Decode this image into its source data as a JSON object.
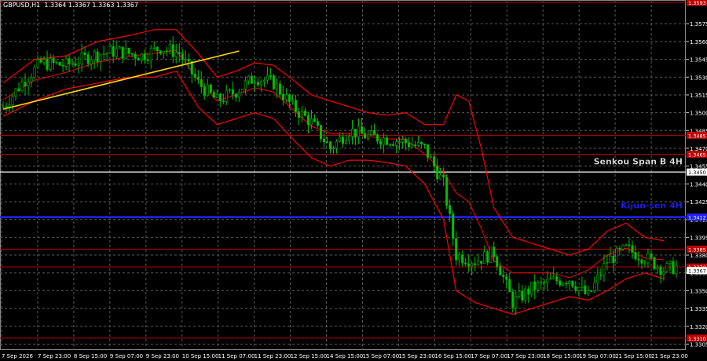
{
  "header": {
    "symbol": "GBPUSD,H1",
    "ohlc": "1.3364 1.3367 1.3363 1.3367"
  },
  "colors": {
    "background": "#000000",
    "grid": "#5a5a5a",
    "candle": "#00c000",
    "indicator": "#ff0000",
    "level_red": "#c00000",
    "senkou": "#e8e8e8",
    "kijun": "#2020ff",
    "trendline": "#ffd700"
  },
  "chart_data": {
    "type": "line",
    "title": "GBPUSD,H1",
    "ylim": [
      1.33,
      1.3595
    ],
    "grid": true,
    "y_ticks": [
      "1.3575",
      "1.3560",
      "1.3545",
      "1.3530",
      "1.3515",
      "1.3500",
      "1.3485",
      "1.3470",
      "1.3455",
      "1.3440",
      "1.3425",
      "1.3410",
      "1.3395",
      "1.3380",
      "1.3365",
      "1.3350",
      "1.3335",
      "1.3320",
      "1.3305"
    ],
    "x_ticks": [
      "7 Sep 2026",
      "7 Sep 23:00",
      "8 Sep 15:00",
      "9 Sep 07:00",
      "9 Sep 23:00",
      "10 Sep 15:00",
      "11 Sep 07:00",
      "11 Sep 23:00",
      "12 Sep 15:00",
      "14 Sep 15:00",
      "15 Sep 07:00",
      "15 Sep 23:00",
      "16 Sep 15:00",
      "17 Sep 07:00",
      "17 Sep 23:00",
      "18 Sep 15:00",
      "19 Sep 07:00",
      "21 Sep 15:00",
      "21 Sep 23:00"
    ],
    "price_path": [
      [
        0,
        1.3505
      ],
      [
        6,
        1.3525
      ],
      [
        12,
        1.3542
      ],
      [
        20,
        1.354
      ],
      [
        28,
        1.3548
      ],
      [
        36,
        1.3552
      ],
      [
        44,
        1.3548
      ],
      [
        50,
        1.3555
      ],
      [
        56,
        1.355
      ],
      [
        62,
        1.3525
      ],
      [
        68,
        1.351
      ],
      [
        74,
        1.3518
      ],
      [
        80,
        1.353
      ],
      [
        86,
        1.3525
      ],
      [
        92,
        1.3505
      ],
      [
        98,
        1.3492
      ],
      [
        104,
        1.347
      ],
      [
        110,
        1.3485
      ],
      [
        116,
        1.348
      ],
      [
        122,
        1.3478
      ],
      [
        128,
        1.3475
      ],
      [
        134,
        1.347
      ],
      [
        140,
        1.344
      ],
      [
        144,
        1.338
      ],
      [
        150,
        1.3375
      ],
      [
        156,
        1.3382
      ],
      [
        162,
        1.334
      ],
      [
        168,
        1.3352
      ],
      [
        174,
        1.3358
      ],
      [
        180,
        1.336
      ],
      [
        186,
        1.3345
      ],
      [
        192,
        1.3375
      ],
      [
        198,
        1.3385
      ],
      [
        204,
        1.3378
      ],
      [
        210,
        1.3368
      ],
      [
        214,
        1.337
      ]
    ],
    "bollinger_upper": [
      [
        0,
        1.3525
      ],
      [
        10,
        1.3545
      ],
      [
        20,
        1.3548
      ],
      [
        30,
        1.356
      ],
      [
        40,
        1.3565
      ],
      [
        48,
        1.357
      ],
      [
        55,
        1.357
      ],
      [
        62,
        1.355
      ],
      [
        68,
        1.353
      ],
      [
        74,
        1.3535
      ],
      [
        80,
        1.3542
      ],
      [
        86,
        1.354
      ],
      [
        92,
        1.3528
      ],
      [
        98,
        1.3515
      ],
      [
        104,
        1.351
      ],
      [
        110,
        1.3505
      ],
      [
        116,
        1.35
      ],
      [
        122,
        1.3498
      ],
      [
        128,
        1.35
      ],
      [
        134,
        1.349
      ],
      [
        140,
        1.349
      ],
      [
        144,
        1.3515
      ],
      [
        148,
        1.351
      ],
      [
        152,
        1.347
      ],
      [
        156,
        1.342
      ],
      [
        162,
        1.3395
      ],
      [
        168,
        1.339
      ],
      [
        174,
        1.3385
      ],
      [
        180,
        1.338
      ],
      [
        186,
        1.3385
      ],
      [
        192,
        1.34
      ],
      [
        198,
        1.3407
      ],
      [
        204,
        1.3395
      ],
      [
        210,
        1.3392
      ]
    ],
    "bollinger_lower": [
      [
        0,
        1.3497
      ],
      [
        10,
        1.351
      ],
      [
        20,
        1.352
      ],
      [
        30,
        1.3525
      ],
      [
        40,
        1.353
      ],
      [
        48,
        1.353
      ],
      [
        55,
        1.3535
      ],
      [
        62,
        1.3505
      ],
      [
        68,
        1.349
      ],
      [
        74,
        1.3495
      ],
      [
        80,
        1.35
      ],
      [
        86,
        1.3495
      ],
      [
        92,
        1.3478
      ],
      [
        98,
        1.3462
      ],
      [
        104,
        1.3455
      ],
      [
        110,
        1.346
      ],
      [
        116,
        1.346
      ],
      [
        122,
        1.3458
      ],
      [
        128,
        1.3455
      ],
      [
        134,
        1.344
      ],
      [
        140,
        1.341
      ],
      [
        144,
        1.335
      ],
      [
        150,
        1.334
      ],
      [
        156,
        1.3335
      ],
      [
        162,
        1.333
      ],
      [
        168,
        1.3335
      ],
      [
        174,
        1.334
      ],
      [
        180,
        1.3345
      ],
      [
        186,
        1.3342
      ],
      [
        192,
        1.335
      ],
      [
        198,
        1.336
      ],
      [
        204,
        1.3365
      ],
      [
        210,
        1.336
      ]
    ],
    "trendline": [
      [
        0,
        1.3503
      ],
      [
        75,
        1.3552
      ]
    ],
    "levels": [
      {
        "label": "1.3593",
        "price": 1.3593,
        "kind": "red"
      },
      {
        "label": "1.3485",
        "price": 1.3481,
        "kind": "red"
      },
      {
        "label": "1.3465",
        "price": 1.3465,
        "kind": "red"
      },
      {
        "label": "1.3450",
        "price": 1.345,
        "kind": "senkou"
      },
      {
        "label": "1.3412",
        "price": 1.3412,
        "kind": "kijun"
      },
      {
        "label": "1.3385",
        "price": 1.3385,
        "kind": "red"
      },
      {
        "label": "1.3370",
        "price": 1.337,
        "kind": "red"
      },
      {
        "label": "1.3310",
        "price": 1.331,
        "kind": "red"
      }
    ],
    "annotations": [
      {
        "text": "Senkou Span B 4H",
        "price": 1.3455,
        "color": "#e8e8e8"
      },
      {
        "text": "Kijun-sen 4H",
        "price": 1.3418,
        "color": "#2020ff"
      }
    ],
    "current_price_label": "1.3367"
  }
}
